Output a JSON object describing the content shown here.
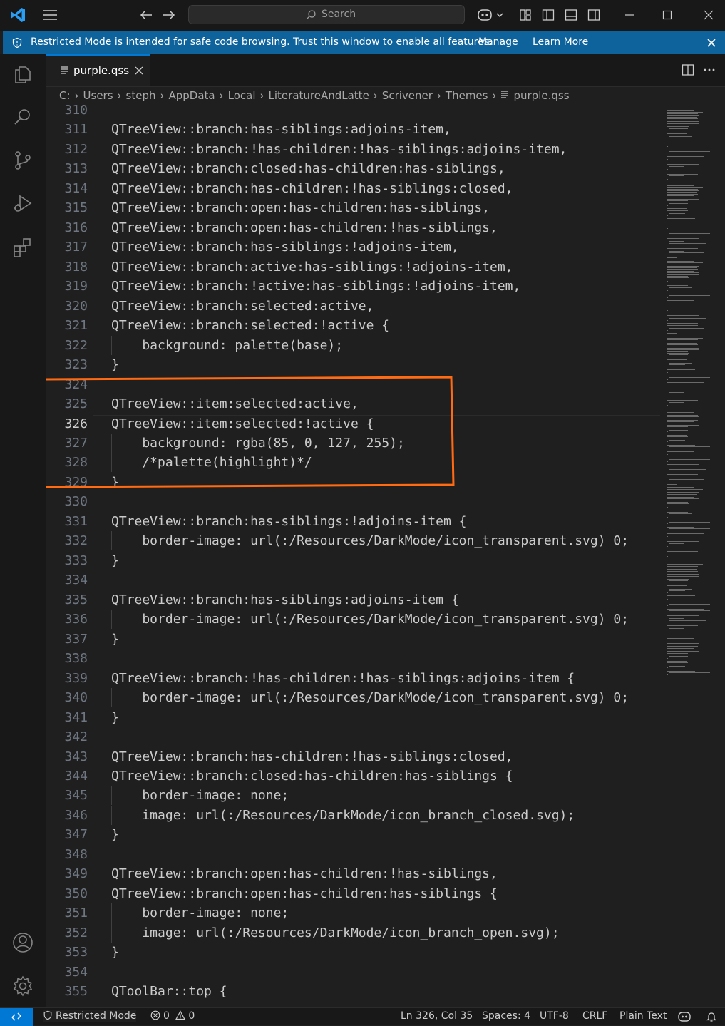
{
  "titlebar": {
    "search_placeholder": "Search"
  },
  "banner": {
    "message": "Restricted Mode is intended for safe code browsing. Trust this window to enable all features.",
    "manage": "Manage",
    "learn_more": "Learn More"
  },
  "tab": {
    "filename": "purple.qss"
  },
  "breadcrumb": [
    "C:",
    "Users",
    "steph",
    "AppData",
    "Local",
    "LiteratureAndLatte",
    "Scrivener",
    "Themes",
    "purple.qss"
  ],
  "editor": {
    "active_line": 326,
    "highlight_color": "#ff6a13",
    "lines": [
      {
        "n": "310",
        "t": ""
      },
      {
        "n": "311",
        "t": "QTreeView::branch:has-siblings:adjoins-item,"
      },
      {
        "n": "312",
        "t": "QTreeView::branch:!has-children:!has-siblings:adjoins-item,"
      },
      {
        "n": "313",
        "t": "QTreeView::branch:closed:has-children:has-siblings,"
      },
      {
        "n": "314",
        "t": "QTreeView::branch:has-children:!has-siblings:closed,"
      },
      {
        "n": "315",
        "t": "QTreeView::branch:open:has-children:has-siblings,"
      },
      {
        "n": "316",
        "t": "QTreeView::branch:open:has-children:!has-siblings,"
      },
      {
        "n": "317",
        "t": "QTreeView::branch:has-siblings:!adjoins-item,"
      },
      {
        "n": "318",
        "t": "QTreeView::branch:active:has-siblings:!adjoins-item,"
      },
      {
        "n": "319",
        "t": "QTreeView::branch:!active:has-siblings:!adjoins-item,"
      },
      {
        "n": "320",
        "t": "QTreeView::branch:selected:active,"
      },
      {
        "n": "321",
        "t": "QTreeView::branch:selected:!active {"
      },
      {
        "n": "322",
        "t": "    background: palette(base);"
      },
      {
        "n": "323",
        "t": "}"
      },
      {
        "n": "324",
        "t": ""
      },
      {
        "n": "325",
        "t": "QTreeView::item:selected:active,"
      },
      {
        "n": "326",
        "t": "QTreeView::item:selected:!active {"
      },
      {
        "n": "327",
        "t": "    background: rgba(85, 0, 127, 255);"
      },
      {
        "n": "328",
        "t": "    /*palette(highlight)*/"
      },
      {
        "n": "329",
        "t": "}"
      },
      {
        "n": "330",
        "t": ""
      },
      {
        "n": "331",
        "t": "QTreeView::branch:has-siblings:!adjoins-item {"
      },
      {
        "n": "332",
        "t": "    border-image: url(:/Resources/DarkMode/icon_transparent.svg) 0;"
      },
      {
        "n": "333",
        "t": "}"
      },
      {
        "n": "334",
        "t": ""
      },
      {
        "n": "335",
        "t": "QTreeView::branch:has-siblings:adjoins-item {"
      },
      {
        "n": "336",
        "t": "    border-image: url(:/Resources/DarkMode/icon_transparent.svg) 0;"
      },
      {
        "n": "337",
        "t": "}"
      },
      {
        "n": "338",
        "t": ""
      },
      {
        "n": "339",
        "t": "QTreeView::branch:!has-children:!has-siblings:adjoins-item {"
      },
      {
        "n": "340",
        "t": "    border-image: url(:/Resources/DarkMode/icon_transparent.svg) 0;"
      },
      {
        "n": "341",
        "t": "}"
      },
      {
        "n": "342",
        "t": ""
      },
      {
        "n": "343",
        "t": "QTreeView::branch:has-children:!has-siblings:closed,"
      },
      {
        "n": "344",
        "t": "QTreeView::branch:closed:has-children:has-siblings {"
      },
      {
        "n": "345",
        "t": "    border-image: none;"
      },
      {
        "n": "346",
        "t": "    image: url(:/Resources/DarkMode/icon_branch_closed.svg);"
      },
      {
        "n": "347",
        "t": "}"
      },
      {
        "n": "348",
        "t": ""
      },
      {
        "n": "349",
        "t": "QTreeView::branch:open:has-children:!has-siblings,"
      },
      {
        "n": "350",
        "t": "QTreeView::branch:open:has-children:has-siblings {"
      },
      {
        "n": "351",
        "t": "    border-image: none;"
      },
      {
        "n": "352",
        "t": "    image: url(:/Resources/DarkMode/icon_branch_open.svg);"
      },
      {
        "n": "353",
        "t": "}"
      },
      {
        "n": "354",
        "t": ""
      },
      {
        "n": "355",
        "t": "QToolBar::top {"
      }
    ]
  },
  "statusbar": {
    "restricted": "Restricted Mode",
    "errors": "0",
    "warnings": "0",
    "position": "Ln 326, Col 35",
    "spaces": "Spaces: 4",
    "encoding": "UTF-8",
    "eol": "CRLF",
    "language": "Plain Text"
  },
  "colors": {
    "accent": "#0078d4",
    "banner": "#0e639c",
    "editor_bg": "#1f1f1f",
    "chrome_bg": "#181818"
  }
}
